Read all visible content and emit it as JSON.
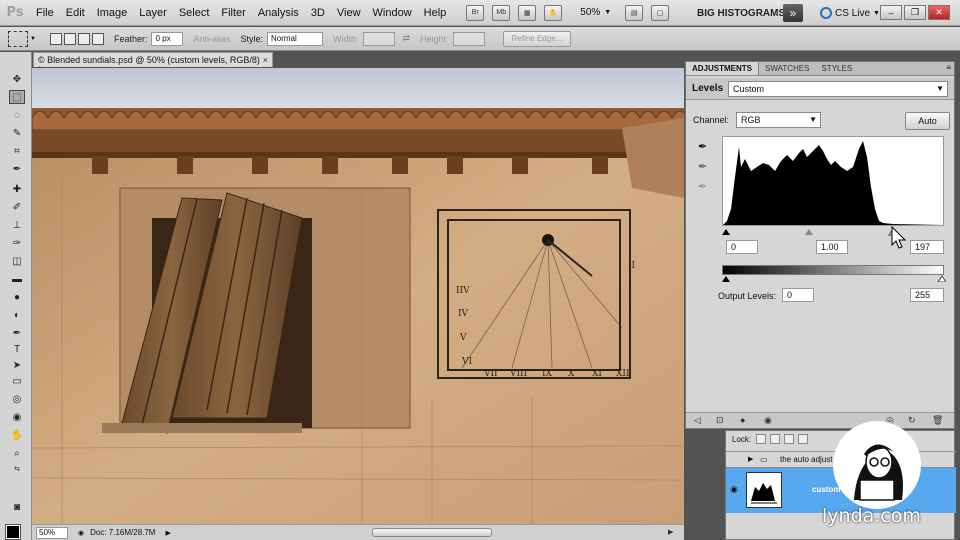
{
  "app": {
    "logo": "Ps"
  },
  "menubar": {
    "items": [
      "File",
      "Edit",
      "Image",
      "Layer",
      "Select",
      "Filter",
      "Analysis",
      "3D",
      "View",
      "Window",
      "Help"
    ],
    "bridge_label": "Br",
    "minibridge_label": "Mb",
    "zoom": "50%",
    "workspace": "BIG HISTOGRAMS",
    "workspace_more": "»",
    "cs_live": "CS Live",
    "win_min": "‒",
    "win_max": "❐",
    "win_close": "✕"
  },
  "options": {
    "feather_label": "Feather:",
    "feather_value": "0 px",
    "antialias_label": "Anti-alias",
    "style_label": "Style:",
    "style_value": "Normal",
    "width_label": "Width:",
    "height_label": "Height:",
    "refine_edge": "Refine Edge..."
  },
  "document": {
    "tab_title": "© Blended sundials.psd @ 50% (custom levels, RGB/8) *",
    "tab_close": "×",
    "zoom": "50%",
    "doc_info": "Doc: 7.16M/28.7M"
  },
  "adjustments": {
    "tabs": [
      "ADJUSTMENTS",
      "SWATCHES",
      "STYLES"
    ],
    "title": "Levels",
    "preset": "Custom",
    "channel_label": "Channel:",
    "channel": "RGB",
    "auto_label": "Auto",
    "input_black": "0",
    "input_gamma": "1.00",
    "input_white": "197",
    "output_label": "Output Levels:",
    "output_black": "0",
    "output_white": "255"
  },
  "layers": {
    "lock_label": "Lock:",
    "group_name": "the auto adjust",
    "layer_name": "custom"
  },
  "watermark": {
    "text": "lynda.com"
  },
  "colors": {
    "selection_blue": "#58a8f0",
    "foreground": "#000000",
    "background": "#ffffff"
  }
}
